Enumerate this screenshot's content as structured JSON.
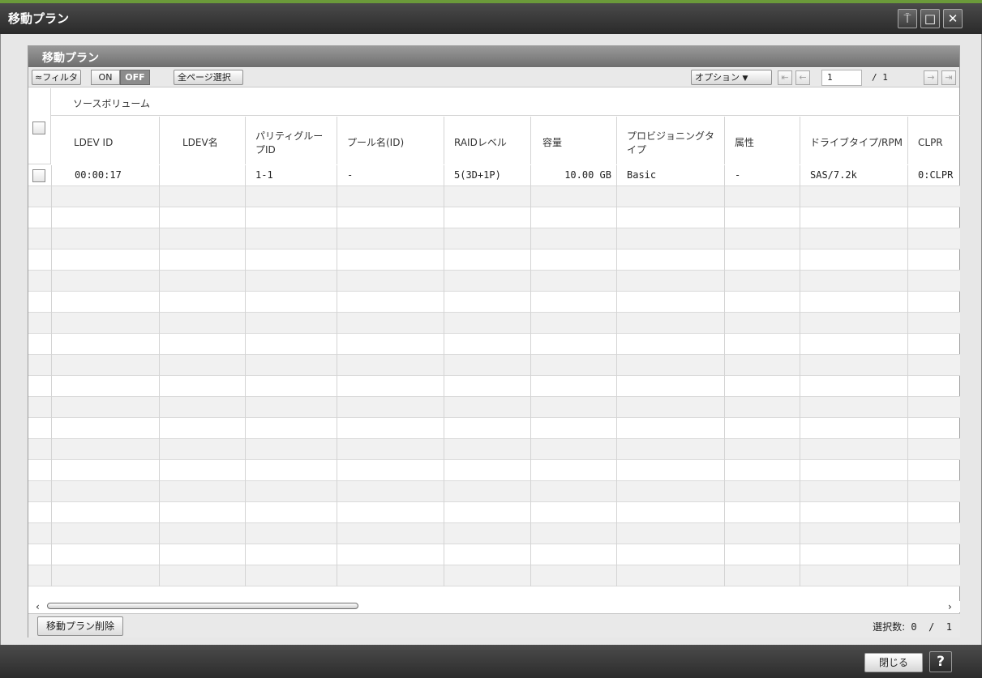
{
  "window": {
    "title": "移動プラン",
    "pin_icon": "pin-icon",
    "maximize_icon": "maximize-icon",
    "close_icon": "close-icon"
  },
  "panel": {
    "title": "移動プラン",
    "toolbar": {
      "filter_label": "フィルタ",
      "on_label": "ON",
      "off_label": "OFF",
      "select_all_pages_label": "全ページ選択",
      "options_label": "オプション",
      "current_page": "1",
      "total_pages": "/ 1"
    },
    "group_header": "ソースボリューム",
    "columns": [
      "LDEV ID",
      "LDEV名",
      "パリティグループID",
      "プール名(ID)",
      "RAIDレベル",
      "容量",
      "プロビジョニングタイプ",
      "属性",
      "ドライブタイプ/RPM",
      "CLPR"
    ],
    "rows": [
      [
        "00:00:17",
        "",
        "1-1",
        "-",
        "5(3D+1P)",
        "10.00 GB",
        "Basic",
        "-",
        "SAS/7.2k",
        "0:CLPR"
      ]
    ],
    "empty_rows": 19,
    "footer": {
      "delete_button": "移動プラン削除",
      "selection_label": "選択数:",
      "selection_value": "0",
      "selection_total": "1"
    }
  },
  "dialog_footer": {
    "close_button": "閉じる",
    "help_button": "?"
  },
  "colors": {
    "accent": "#6b9a3a",
    "header_dark": "#2a2a2a",
    "panel_header": "#7a7a7a",
    "toggle_off": "#8c8c8c"
  }
}
